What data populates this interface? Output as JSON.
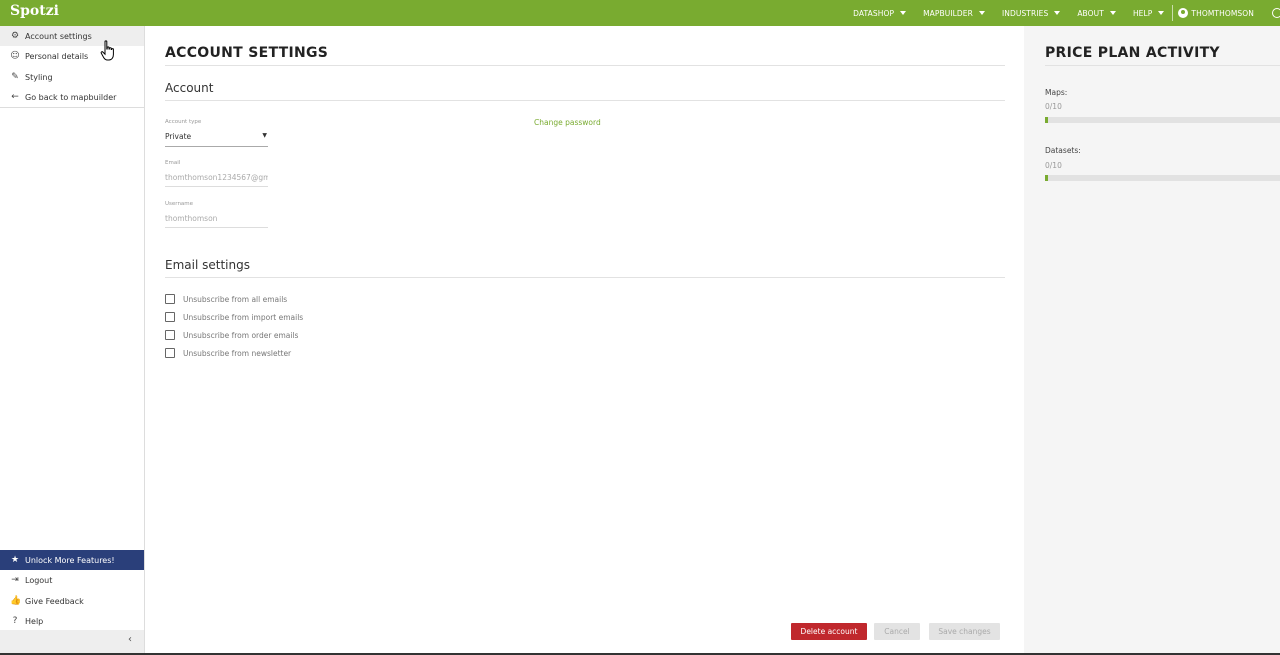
{
  "brand": {
    "logo_text": "Spotzi",
    "accent_color": "#79ab30",
    "danger_color": "#c0282d",
    "promo_color": "#2a3f7a"
  },
  "nav": {
    "items": [
      {
        "label": "DATASHOP"
      },
      {
        "label": "MAPBUILDER"
      },
      {
        "label": "INDUSTRIES"
      },
      {
        "label": "ABOUT"
      },
      {
        "label": "HELP"
      }
    ],
    "user": "THOMTHOMSON"
  },
  "sidebar": {
    "top_items": [
      {
        "label": "Account settings",
        "icon": "gear-icon",
        "active": true
      },
      {
        "label": "Personal details",
        "icon": "face-icon"
      },
      {
        "label": "Styling",
        "icon": "paint-icon"
      },
      {
        "label": "Go back to mapbuilder",
        "icon": "arrow-left-icon"
      }
    ],
    "promo": {
      "label": "Unlock More Features!",
      "icon": "star-icon"
    },
    "bottom_items": [
      {
        "label": "Logout",
        "icon": "logout-icon"
      },
      {
        "label": "Give Feedback",
        "icon": "thumbs-up-icon"
      },
      {
        "label": "Help",
        "icon": "help-icon"
      }
    ],
    "collapse_glyph": "‹"
  },
  "main": {
    "title": "ACCOUNT SETTINGS",
    "account": {
      "heading": "Account",
      "account_type_label": "Account type",
      "account_type_value": "Private",
      "email_label": "Email",
      "email_value": "thomthomson1234567@gma",
      "username_label": "Username",
      "username_value": "thomthomson",
      "change_password": "Change password"
    },
    "email_settings": {
      "heading": "Email settings",
      "options": [
        {
          "label": "Unsubscribe from all emails",
          "checked": false
        },
        {
          "label": "Unsubscribe from import emails",
          "checked": false
        },
        {
          "label": "Unsubscribe from order emails",
          "checked": false
        },
        {
          "label": "Unsubscribe from newsletter",
          "checked": false
        }
      ]
    },
    "buttons": {
      "delete": "Delete account",
      "cancel": "Cancel",
      "save": "Save changes"
    }
  },
  "price_plan": {
    "title": "PRICE PLAN ACTIVITY",
    "maps": {
      "label": "Maps:",
      "count": "0/10",
      "fraction": 0.0
    },
    "datasets": {
      "label": "Datasets:",
      "count": "0/10",
      "fraction": 0.0
    }
  }
}
